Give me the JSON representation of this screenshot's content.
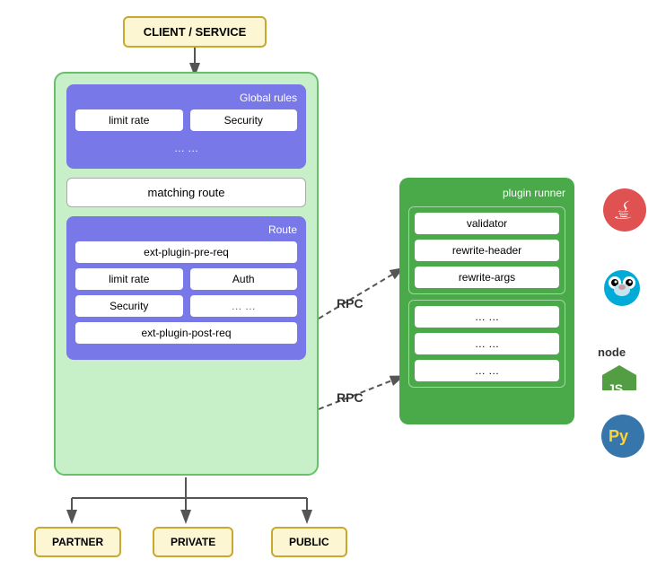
{
  "client_box": {
    "label": "CLIENT / SERVICE"
  },
  "global_rules": {
    "title": "Global rules",
    "pill1": "limit rate",
    "pill2": "Security",
    "dots": "… …"
  },
  "matching_route": {
    "label": "matching route"
  },
  "route": {
    "title": "Route",
    "ext_pre": "ext-plugin-pre-req",
    "pill1": "limit rate",
    "pill2": "Auth",
    "pill3": "Security",
    "dots": "… …",
    "ext_post": "ext-plugin-post-req"
  },
  "plugin_runner": {
    "title": "plugin runner",
    "validator": "validator",
    "rewrite_header": "rewrite-header",
    "rewrite_args": "rewrite-args",
    "dots1": "… …",
    "dots2": "… …",
    "dots3": "… …"
  },
  "rpc1": {
    "label": "RPC"
  },
  "rpc2": {
    "label": "RPC"
  },
  "bottom": {
    "partner": "PARTNER",
    "private": "PRIVATE",
    "public": "PUBLIC"
  },
  "colors": {
    "yellow_border": "#c8a832",
    "yellow_bg": "#fdf6d3",
    "green_bg": "#c8f0c8",
    "blue_bg": "#7878e8",
    "dark_green": "#4aaa4a"
  }
}
